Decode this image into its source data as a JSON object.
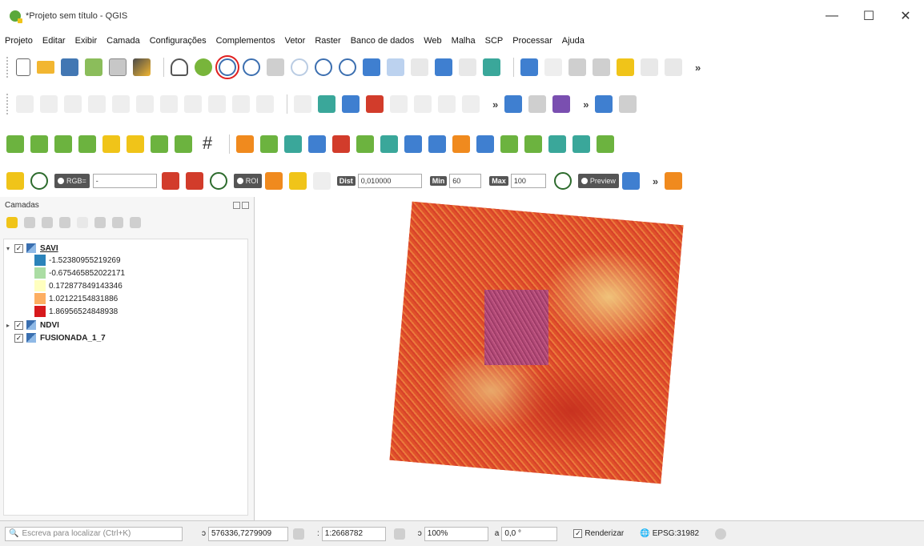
{
  "window": {
    "title": "*Projeto sem título - QGIS",
    "controls": {
      "minimize": "—",
      "maximize": "☐",
      "close": "✕"
    }
  },
  "menubar": [
    "Projeto",
    "Editar",
    "Exibir",
    "Camada",
    "Configurações",
    "Complementos",
    "Vetor",
    "Raster",
    "Banco de dados",
    "Web",
    "Malha",
    "SCP",
    "Processar",
    "Ajuda"
  ],
  "toolbar": {
    "overflow": "»",
    "scp": {
      "rgb_label": "RGB=",
      "rgb_value": "-",
      "roi_label": "ROI",
      "dist_label": "Dist",
      "dist_value": "0,010000",
      "min_label": "Min",
      "min_value": "60",
      "max_label": "Max",
      "max_value": "100",
      "preview_label": "Preview"
    }
  },
  "layers_panel": {
    "title": "Camadas",
    "layers": [
      {
        "name": "SAVI",
        "checked": "✓",
        "legend": [
          {
            "color": "#2b83ba",
            "label": "-1.52380955219269"
          },
          {
            "color": "#abdda4",
            "label": "-0.675465852022171"
          },
          {
            "color": "#ffffbf",
            "label": "0.172877849143346"
          },
          {
            "color": "#fdae61",
            "label": "1.02122154831886"
          },
          {
            "color": "#d7191c",
            "label": "1.86956524848938"
          }
        ]
      },
      {
        "name": "NDVI",
        "checked": "✓"
      },
      {
        "name": "FUSIONADA_1_7",
        "checked": "✓"
      }
    ]
  },
  "statusbar": {
    "search_placeholder": "Escreva para localizar (Ctrl+K)",
    "coord_label": "ɔ",
    "coordinate": "576336,7279909",
    "scale_label": ":",
    "scale": "1:2668782",
    "magnifier_label": "ɔ",
    "magnifier": "100%",
    "rotation_label": "a",
    "rotation": "0,0 °",
    "render_label": "Renderizar",
    "render_checked": "✓",
    "crs": "EPSG:31982"
  }
}
